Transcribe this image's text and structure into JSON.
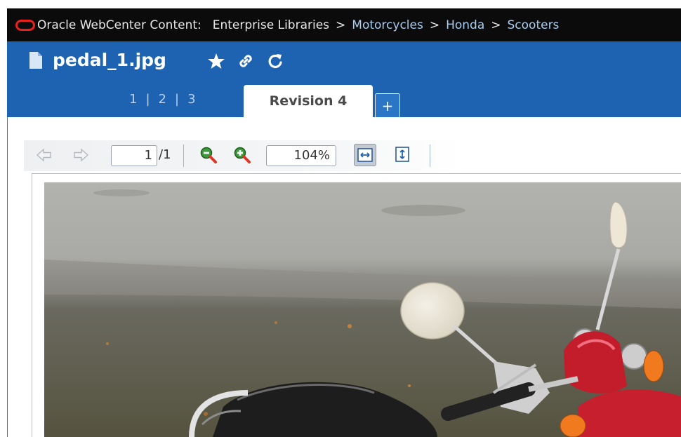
{
  "header": {
    "app_name": "Oracle WebCenter Content:",
    "breadcrumb": [
      {
        "label": "Enterprise Libraries",
        "link": false
      },
      {
        "label": "Motorcycles",
        "link": true
      },
      {
        "label": "Honda",
        "link": true
      },
      {
        "label": "Scooters",
        "link": true
      }
    ],
    "separator": ">"
  },
  "document": {
    "title": "pedal_1.jpg",
    "actions": [
      "star-icon",
      "link-icon",
      "refresh-icon"
    ]
  },
  "revisions": {
    "links": [
      "1",
      "2",
      "3"
    ],
    "divider": "|",
    "active_tab": "Revision 4",
    "add_label": "+"
  },
  "viewer": {
    "page_current": "1",
    "page_total": "/1",
    "zoom": "104%"
  },
  "colors": {
    "topbar": "#0b0b0b",
    "brand_red": "#e8221a",
    "header_blue": "#1e63b2",
    "link_blue": "#a8cdf0"
  }
}
